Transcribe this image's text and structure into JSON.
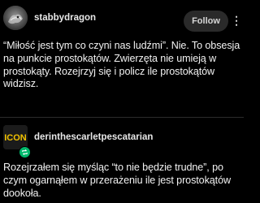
{
  "post1": {
    "username": "stabbydragon",
    "follow_label": "Follow",
    "more_icon": "more-vertical-icon",
    "text": "“Miłość jest tym co czyni nas ludźmi”. Nie. To obsesja na punkcie prostokątów. Zwierzęta nie umieją w prostokąty. Rozejrzyj się i policz ile prostokątów widzisz."
  },
  "post2": {
    "username": "derinthescarletpescatarian",
    "avatar_text": "ICON",
    "badge_icon": "reblog-icon",
    "text": "Rozejrzałem się myśląc “to nie będzie trudne”, po czym ogarnąłem w przerażeniu ile jest prostokątów dookoła."
  },
  "colors": {
    "background": "#000000",
    "follow_button": "#2a2a2a",
    "badge_green": "#00b86b",
    "icon_avatar_yellow": "#f2c200"
  }
}
